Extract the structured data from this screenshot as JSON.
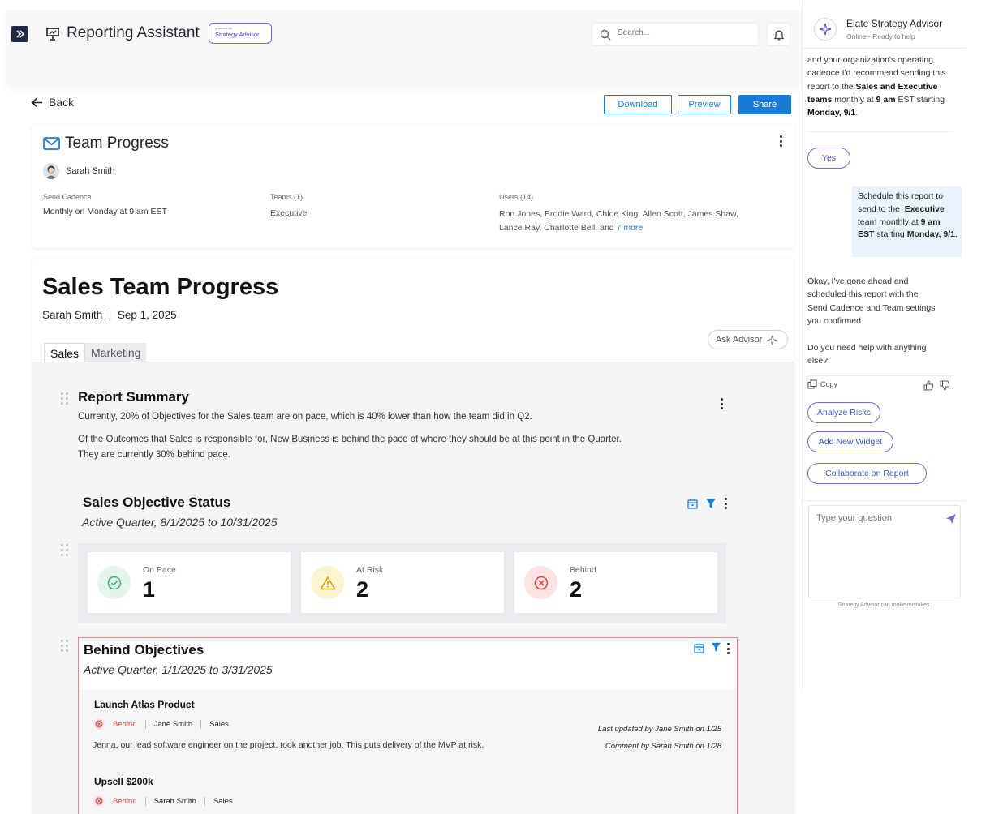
{
  "header": {
    "app_title": "Reporting Assistant",
    "badge_small": "powered by",
    "badge_text": "Strategy Advisor",
    "search_placeholder": "Search..."
  },
  "toolbar": {
    "back_label": "Back",
    "download_label": "Download",
    "preview_label": "Preview",
    "share_label": "Share"
  },
  "team_card": {
    "title": "Team Progress",
    "owner": "Sarah Smith",
    "cadence_label": "Send Cadence",
    "cadence_value": "Monthly on Monday at 9 am EST",
    "teams_label": "Teams (1)",
    "teams_value": "Executive",
    "users_label": "Users (14)",
    "users_line1": "Ron Jones, Brodie Ward, Chloe King, Allen Scott, James Shaw,",
    "users_line2": "Lance Ray, Charlotte Bell, and",
    "users_more": "7 more"
  },
  "report": {
    "title": "Sales Team Progress",
    "author": "Sarah Smith",
    "date": "Sep 1, 2025",
    "ask_advisor": "Ask Advisor",
    "tabs": [
      {
        "label": "Sales",
        "active": true
      },
      {
        "label": "Marketing",
        "active": false
      }
    ],
    "summary": {
      "title": "Report Summary",
      "p1": "Currently, 20% of Objectives for the Sales team are on pace, which is 40% lower than how the team did in Q2.",
      "p2": "Of the Outcomes that Sales is responsible for, New Business is behind the pace of where they should be at this point in the Quarter.",
      "p3": "They are currently 30% behind pace."
    },
    "objective_status": {
      "title": "Sales Objective Status",
      "subtitle": "Active Quarter, 8/1/2025 to 10/31/2025",
      "stats": [
        {
          "label": "On Pace",
          "value": "1",
          "color": "#3cb371"
        },
        {
          "label": "At Risk",
          "value": "2",
          "color": "#e0b100"
        },
        {
          "label": "Behind",
          "value": "2",
          "color": "#e0433b"
        }
      ]
    },
    "behind_objectives": {
      "title": "Behind Objectives",
      "subtitle": "Active Quarter, 1/1/2025 to 3/31/2025",
      "items": [
        {
          "title": "Launch Atlas Product",
          "status": "Behind",
          "owner": "Jane Smith",
          "team": "Sales",
          "description": "Jenna, our lead software engineer on the project, took another job. This puts delivery of the MVP at risk.",
          "updated": "Last updated by Jane Smith on 1/25",
          "comment": "Comment by Sarah Smith on 1/28"
        },
        {
          "title": "Upsell $200k",
          "status": "Behind",
          "owner": "Sarah Smith",
          "team": "Sales"
        }
      ]
    }
  },
  "advisor": {
    "name": "Elate Strategy Advisor",
    "status": "Online - Ready to help",
    "yes_label": "Yes",
    "reply_line1": "Okay, I've gone ahead and",
    "reply_line2": "scheduled this report with the",
    "reply_line3": "Send Cadence and Team settings",
    "reply_line4": "you confirmed.",
    "followup_line1": "Do you need help with anything",
    "followup_line2": "else?",
    "copy_label": "Copy",
    "actions": [
      "Analyze Risks",
      "Add New Widget",
      "Collaborate on Report"
    ],
    "question_placeholder": "Type your question",
    "disclaimer": "Strategy Advisor can make mistakes."
  },
  "colors": {
    "accent": "#1a7bd6",
    "advisor_purple": "#7b6ad6",
    "danger": "#e0433b",
    "nav_dark": "#1f2b44"
  }
}
